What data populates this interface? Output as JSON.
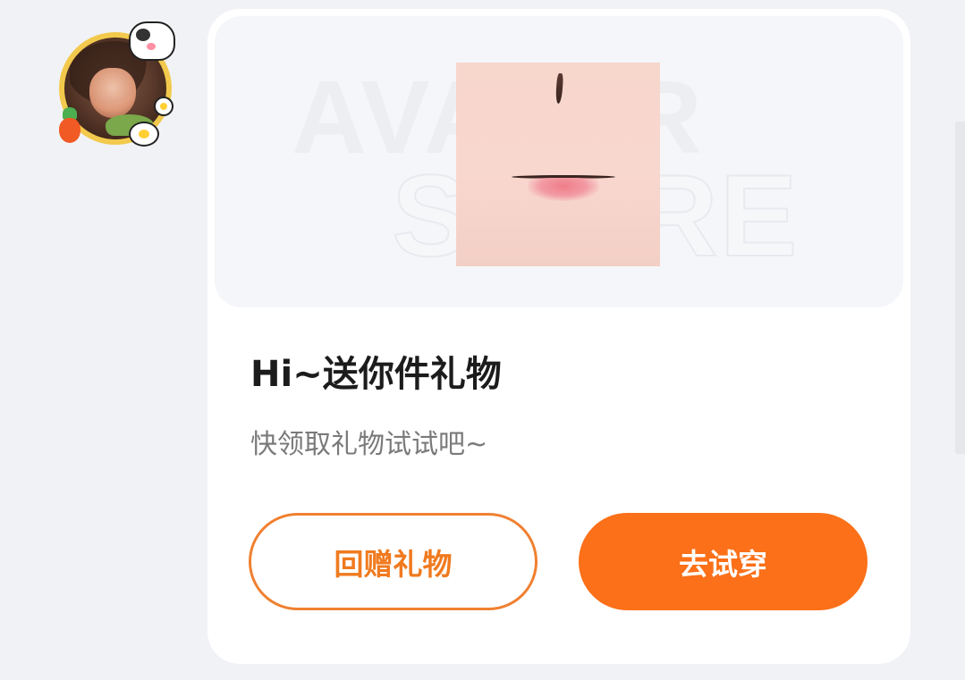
{
  "message": {
    "title": "Hi~送你件礼物",
    "subtitle": "快领取礼物试试吧~"
  },
  "hero": {
    "watermark_line1": "AVATAR",
    "watermark_line2": "STORE",
    "product_image": "lip-makeup-item"
  },
  "actions": {
    "return_gift_label": "回赠礼物",
    "try_on_label": "去试穿"
  },
  "colors": {
    "accent": "#fb7018",
    "background": "#f1f2f5",
    "card": "#ffffff"
  }
}
